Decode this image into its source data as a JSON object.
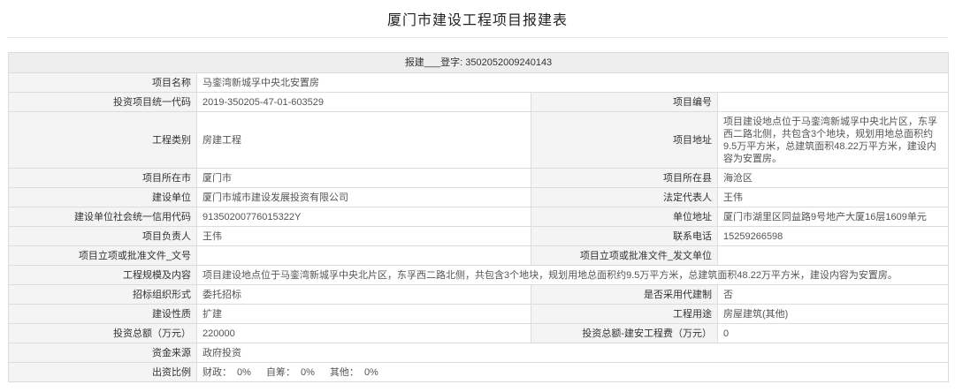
{
  "title": "厦门市建设工程项目报建表",
  "header_row": {
    "prefix": "报建",
    "blank": "___",
    "reg_label": "登字:",
    "reg_no": "3502052009240143"
  },
  "fields": {
    "project_name_label": "项目名称",
    "project_name": "马銮湾新城孚中央北安置房",
    "invest_code_label": "投资项目统一代码",
    "invest_code": "2019-350205-47-01-603529",
    "project_no_label": "项目编号",
    "project_no": "",
    "eng_type_label": "工程类别",
    "eng_type": "房建工程",
    "address_label": "项目地址",
    "address": "项目建设地点位于马銮湾新城孚中央北片区，东孚西二路北侧，共包含3个地块，规划用地总面积约9.5万平方米，总建筑面积48.22万平方米，建设内容为安置房。",
    "city_label": "项目所在市",
    "city": "厦门市",
    "county_label": "项目所在县",
    "county": "海沧区",
    "builder_label": "建设单位",
    "builder": "厦门市城市建设发展投资有限公司",
    "legal_rep_label": "法定代表人",
    "legal_rep": "王伟",
    "credit_code_label": "建设单位社会统一信用代码",
    "credit_code": "91350200776015322Y",
    "unit_address_label": "单位地址",
    "unit_address": "厦门市湖里区同益路9号地产大厦16层1609单元",
    "leader_label": "项目负责人",
    "leader": "王伟",
    "phone_label": "联系电话",
    "phone": "15259266598",
    "approval_doc_no_label": "项目立项或批准文件_文号",
    "approval_doc_no": "",
    "approval_issuer_label": "项目立项或批准文件_发文单位",
    "approval_issuer": "",
    "scale_label": "工程规模及内容",
    "scale": "项目建设地点位于马銮湾新城孚中央北片区，东孚西二路北侧，共包含3个地块，规划用地总面积约9.5万平方米，总建筑面积48.22万平方米，建设内容为安置房。",
    "bid_form_label": "招标组织形式",
    "bid_form": "委托招标",
    "agent_label": "是否采用代建制",
    "agent": "否",
    "nature_label": "建设性质",
    "nature": "扩建",
    "usage_label": "工程用途",
    "usage": "房屋建筑(其他)",
    "invest_total_label": "投资总额（万元）",
    "invest_total": "220000",
    "invest_install_label": "投资总额-建安工程费（万元）",
    "invest_install": "0",
    "fund_source_label": "资金来源",
    "fund_source": "政府投资",
    "ratio_label": "出资比例",
    "ratio": {
      "fiscal_label": "财政：",
      "fiscal": "0%",
      "self_label": "自筹：",
      "self": "0%",
      "other_label": "其他：",
      "other": "0%"
    }
  }
}
